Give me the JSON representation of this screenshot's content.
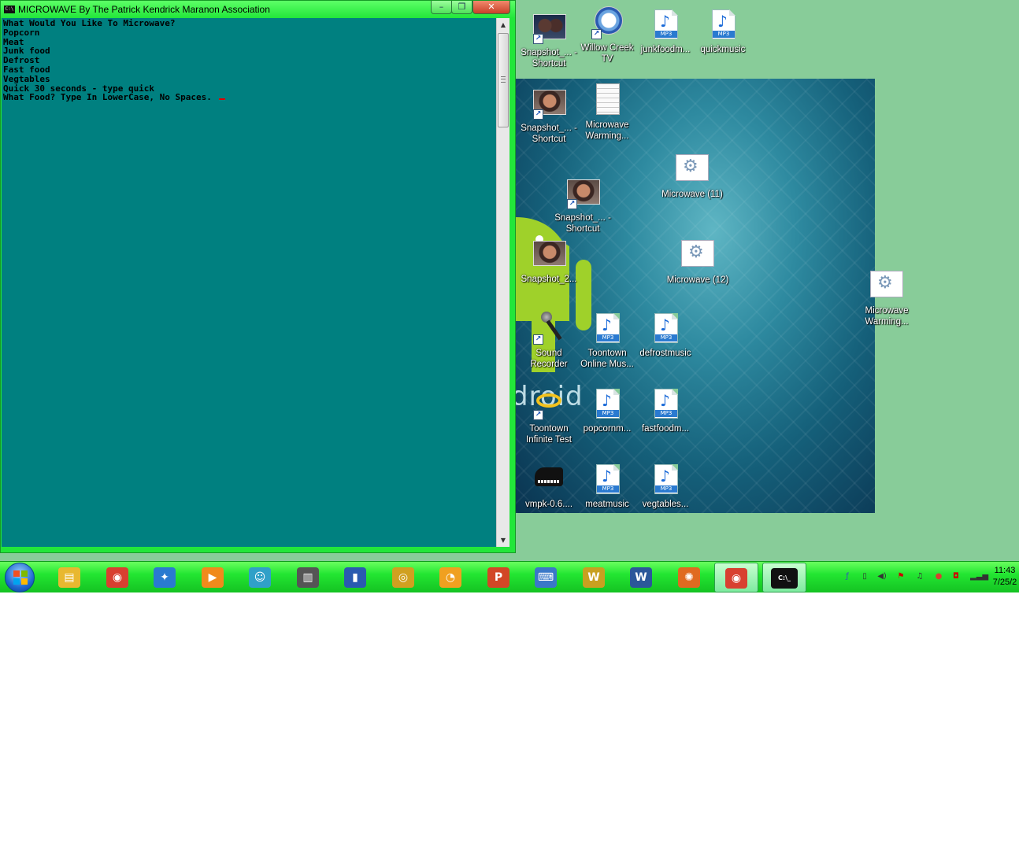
{
  "console": {
    "title": "MICROWAVE By The Patrick Kendrick Maranon Association",
    "icon_text": "C:\\",
    "lines": [
      "What Would You Like To Microwave?",
      "Popcorn",
      "Meat",
      "Junk food",
      "Defrost",
      "Fast food",
      "Vegtables",
      "Quick 30 seconds - type quick",
      "What Food? Type In LowerCase, No Spaces. "
    ],
    "minimize_label": "–",
    "maximize_label": "❐",
    "close_label": "✕"
  },
  "desktop": {
    "icons": [
      {
        "label": "Snapshot_... - Shortcut",
        "icon": "photo-shortcut-icon"
      },
      {
        "label": "Willow Creek TV",
        "icon": "safari-shortcut-icon"
      },
      {
        "label": "junkfoodm...",
        "icon": "mp3-file-icon"
      },
      {
        "label": "quickmusic",
        "icon": "mp3-file-icon"
      },
      {
        "label": "Snapshot_... - Shortcut",
        "icon": "photo-shortcut-icon"
      },
      {
        "label": "Microwave Warming...",
        "icon": "text-file-icon"
      },
      {
        "label": "Microwave (11)",
        "icon": "gear-file-icon"
      },
      {
        "label": "Snapshot_... - Shortcut",
        "icon": "photo-shortcut-icon"
      },
      {
        "label": "Microwave (12)",
        "icon": "gear-file-icon"
      },
      {
        "label": "Snapshot_2...",
        "icon": "photo-icon"
      },
      {
        "label": "Microwave Warming...",
        "icon": "gear-file-icon"
      },
      {
        "label": "Sound Recorder",
        "icon": "microphone-shortcut-icon"
      },
      {
        "label": "Toontown Online Mus...",
        "icon": "mp3-file-icon"
      },
      {
        "label": "defrostmusic",
        "icon": "mp3-file-icon"
      },
      {
        "label": "Toontown Infinite Test",
        "icon": "toontown-shortcut-icon"
      },
      {
        "label": "popcornm...",
        "icon": "mp3-file-icon"
      },
      {
        "label": "fastfoodm...",
        "icon": "mp3-file-icon"
      },
      {
        "label": "vmpk-0.6....",
        "icon": "piano-icon"
      },
      {
        "label": "meatmusic",
        "icon": "mp3-file-icon"
      },
      {
        "label": "vegtables...",
        "icon": "mp3-file-icon"
      }
    ],
    "mp3_tag": "MP3",
    "wallpaper_text": "droid"
  },
  "taskbar": {
    "buttons": [
      {
        "name": "file-explorer-icon",
        "glyph": "▤",
        "color": "#e8b830"
      },
      {
        "name": "chrome-icon",
        "glyph": "◉",
        "color": "#d84030"
      },
      {
        "name": "safari-icon",
        "glyph": "✦",
        "color": "#2a7ad0"
      },
      {
        "name": "media-player-icon",
        "glyph": "▶",
        "color": "#f08a1c"
      },
      {
        "name": "mascot-app-icon",
        "glyph": "☺",
        "color": "#30a0c8"
      },
      {
        "name": "reader-app-icon",
        "glyph": "▥",
        "color": "#555555"
      },
      {
        "name": "exit-door-app-icon",
        "glyph": "▮",
        "color": "#2a5ab0"
      },
      {
        "name": "music-player-icon",
        "glyph": "◎",
        "color": "#d0a020"
      },
      {
        "name": "stopwatch-icon",
        "glyph": "◔",
        "color": "#f0a020"
      },
      {
        "name": "powerpoint-icon",
        "glyph": "P",
        "color": "#d24726"
      },
      {
        "name": "keyboard-app-icon",
        "glyph": "⌨",
        "color": "#3a78c8"
      },
      {
        "name": "toontown-app-icon",
        "glyph": "W",
        "color": "#c8a020"
      },
      {
        "name": "word-icon",
        "glyph": "W",
        "color": "#2b579a"
      },
      {
        "name": "firefox-icon",
        "glyph": "✺",
        "color": "#e06a20"
      },
      {
        "name": "chrome-icon",
        "glyph": "◉",
        "color": "#d84030"
      },
      {
        "name": "command-prompt-icon",
        "glyph": "C:\\_",
        "color": "#111111"
      }
    ],
    "clock_time": "11:43",
    "clock_date": "7/25/2"
  },
  "colors": {
    "desktop_bg": "#88cc99",
    "console_bg": "#008080",
    "window_frame": "#22e63a",
    "taskbar": "#23e632"
  }
}
